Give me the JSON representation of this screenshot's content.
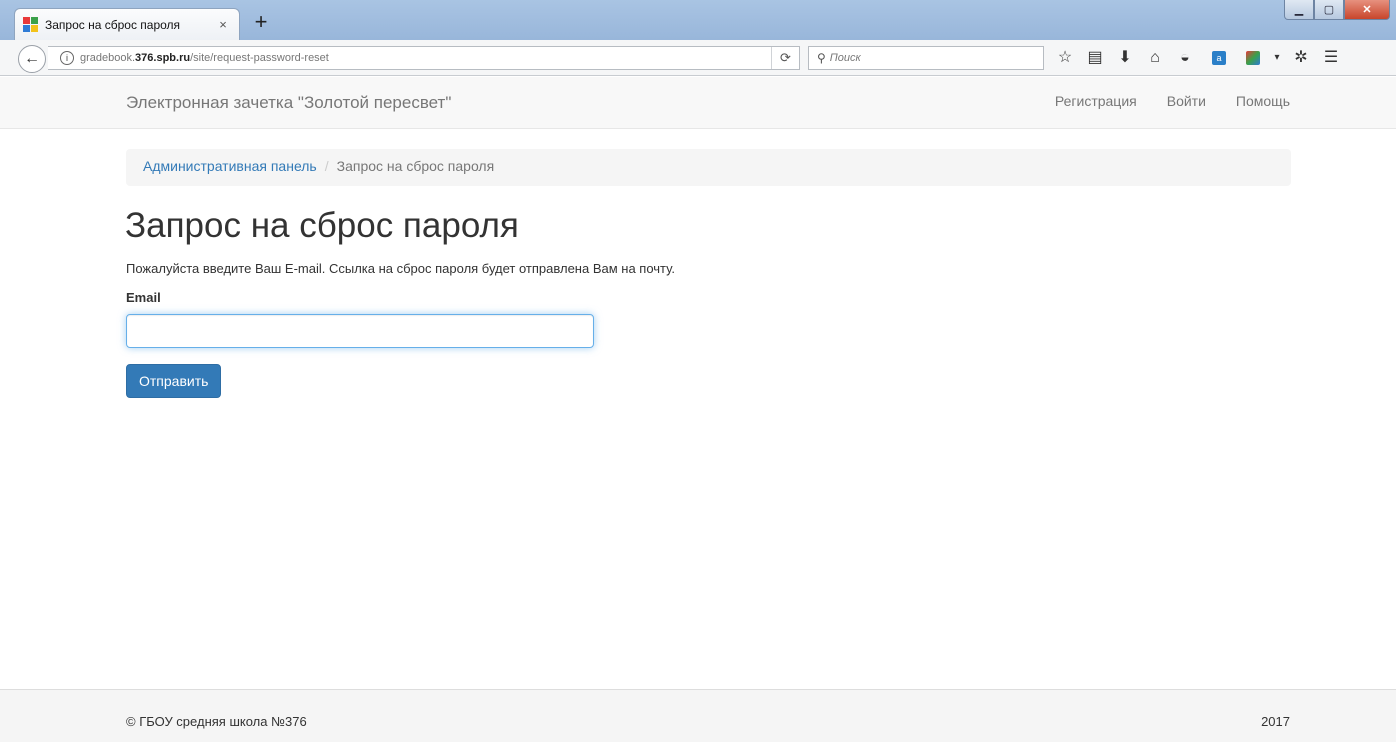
{
  "browser": {
    "tab_title": "Запрос на сброс пароля",
    "tab_close": "×",
    "new_tab": "+",
    "url_host": "gradebook.376.spb.ru",
    "url_path": "/site/request-password-reset",
    "url_prefix": "gradebook.",
    "url_bold": "376.spb.ru",
    "search_placeholder": "Поиск",
    "icons": [
      "back-arrow-icon",
      "info-icon",
      "reload-icon",
      "search-icon",
      "bookmark-star-icon",
      "reading-list-icon",
      "download-icon",
      "home-icon",
      "pocket-icon",
      "extension-icon",
      "flag-extension-icon",
      "dropdown-icon",
      "devtools-icon",
      "menu-icon"
    ]
  },
  "site": {
    "brand": "Электронная зачетка \"Золотой пересвет\"",
    "nav": {
      "register": "Регистрация",
      "login": "Войти",
      "help": "Помощь"
    },
    "breadcrumb": {
      "home": "Административная панель",
      "separator": "/",
      "current": "Запрос на сброс пароля"
    },
    "page_title": "Запрос на сброс пароля",
    "lead": "Пожалуйста введите Ваш E-mail. Ссылка на сброс пароля будет отправлена Вам на почту.",
    "form": {
      "email_label": "Email",
      "email_value": "",
      "submit_label": "Отправить"
    },
    "footer": {
      "copyright": "© ГБОУ средняя школа №376",
      "year": "2017"
    }
  },
  "colors": {
    "link": "#337ab7",
    "primary_button": "#337ab7",
    "navbar_bg": "#f8f8f8",
    "titlebar": "#a9c4e3"
  }
}
